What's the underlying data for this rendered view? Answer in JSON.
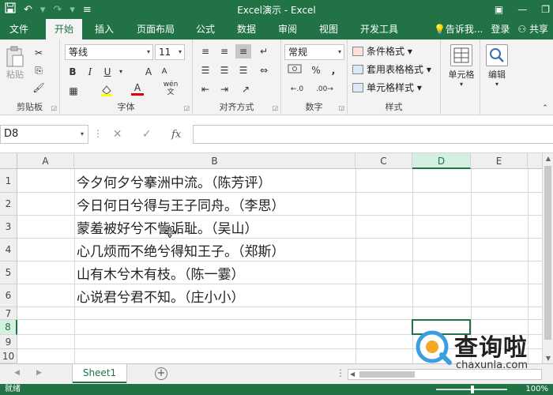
{
  "titlebar": {
    "title": "Excel演示 - Excel",
    "undo_icon": "↶",
    "undo_dd": "▾",
    "redo_icon": "↷",
    "redo_dd": "▾",
    "qa_more": "≡",
    "help_icon": "▣",
    "minimize_icon": "—",
    "restore_icon": "❐"
  },
  "tabs": {
    "items": [
      "文件",
      "开始",
      "插入",
      "页面布局",
      "公式",
      "数据",
      "审阅",
      "视图",
      "开发工具"
    ],
    "active_index": 1,
    "tell_me": "告诉我...",
    "sign_in": "登录",
    "share": "共享"
  },
  "ribbon": {
    "clipboard": {
      "label": "剪贴板",
      "paste": "粘贴"
    },
    "font": {
      "label": "字体",
      "name": "等线",
      "size": "11",
      "bold": "B",
      "italic": "I",
      "underline": "U",
      "grow": "A",
      "shrink": "A",
      "font_color": "A",
      "phonetic": "wén"
    },
    "alignment": {
      "label": "对齐方式"
    },
    "number": {
      "label": "数字",
      "format": "常规",
      "currency": "¥",
      "percent": "%",
      "comma": ","
    },
    "styles": {
      "label": "样式",
      "conditional": "条件格式",
      "table": "套用表格格式",
      "cell_styles": "单元格样式"
    },
    "cells": {
      "label": "单元格"
    },
    "editing": {
      "label": "编辑"
    }
  },
  "formula_bar": {
    "name_box": "D8",
    "cancel": "✕",
    "enter": "✓",
    "fx": "fx",
    "value": ""
  },
  "grid": {
    "columns": [
      "A",
      "B",
      "C",
      "D",
      "E"
    ],
    "selected_column": "D",
    "rows": [
      "1",
      "2",
      "3",
      "4",
      "5",
      "6",
      "7",
      "8",
      "9",
      "10"
    ],
    "selected_row": "8",
    "cells_b": [
      "今夕何夕兮搴洲中流。（陈芳评）",
      "今日何日兮得与王子同舟。（李思）",
      "蒙羞被好兮不訾诟耻。（吴山）",
      "心几烦而不绝兮得知王子。（郑斯）",
      "山有木兮木有枝。（陈一霎）",
      "心说君兮君不知。（庄小小）"
    ]
  },
  "sheets": {
    "tabs": [
      "Sheet1"
    ],
    "add": "+"
  },
  "statusbar": {
    "status": "就绪",
    "zoom": "100%"
  },
  "watermark": {
    "name": "查询啦",
    "url": "chaxunla.com"
  },
  "colors": {
    "accent": "#217346",
    "selection_fill": "#d3f0e0"
  }
}
